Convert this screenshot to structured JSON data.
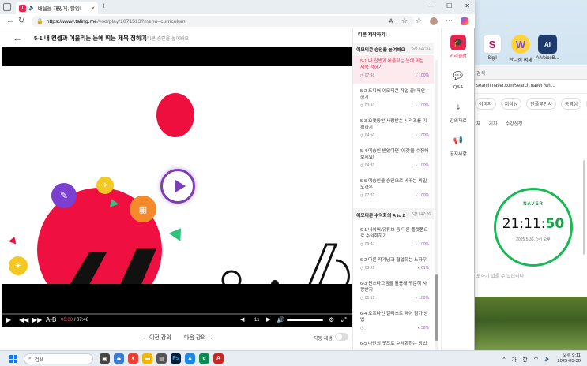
{
  "browser": {
    "tab_title": "배움을 재밌게, 탈잉!",
    "url_host": "https://www.taling.me",
    "url_path": "/vod/play/1071513?menu=curriculum"
  },
  "page": {
    "lesson_title": "5-1 내 컨셉과 어울리는 눈에 띄는 제목 정하기",
    "chapter": "이모티콘 승인율 높여봐요"
  },
  "player": {
    "ab_label": "A-B",
    "time_current": "00:00",
    "time_separator": "/",
    "time_total": "07:48",
    "speed": "1x"
  },
  "below_video": {
    "prev_label": "이전 강의",
    "next_label": "다음 강의",
    "autoplay_label": "자동 재생"
  },
  "curriculum": {
    "top_text": "티콘 제작하기!",
    "chapters": [
      {
        "name": "이모티콘 승인율 높여봐요",
        "count": "5강 / 27:51",
        "lessons": [
          {
            "title": "5-1 내 컨셉과 어울리는 눈에 띄는 제목 정하기",
            "duration": "07:48",
            "progress": "100%",
            "active": true
          },
          {
            "title": "5-2 드디어 이모티콘 작업 끝! 제안하기",
            "duration": "03:10",
            "progress": "100%"
          },
          {
            "title": "5-3 오랫동안 사랑받는 시리즈를 기획하기",
            "duration": "04:50",
            "progress": "100%"
          },
          {
            "title": "5-4 미승인 받았다면 '이것'을 수정해 보세요!",
            "duration": "04:31",
            "progress": "100%"
          },
          {
            "title": "5-5 미승인을 승인으로 바꾸는 비밀 노하우",
            "duration": "07:32",
            "progress": "100%"
          }
        ]
      },
      {
        "name": "이모티콘 수익화의 A to Z",
        "count": "5강 / 47:26",
        "lessons": [
          {
            "title": "6-1 네이버/유튜브 등 다른 플랫폼으로 수익화하기",
            "duration": "09:47",
            "progress": "100%"
          },
          {
            "title": "6-2 다른 작가님과 협업하는 노하우",
            "duration": "03:21",
            "progress": "61%"
          },
          {
            "title": "6-3 인스타그램을 활용해 꾸준히 사랑받기",
            "duration": "05:12",
            "progress": "100%"
          },
          {
            "title": "6-4 오프라인 일러스트 페어 참가 방법",
            "duration": "",
            "progress": "58%"
          },
          {
            "title": "6-5 나만의 굿즈로 수익화하는 방법",
            "duration": "",
            "progress": ""
          }
        ]
      }
    ]
  },
  "right_nav": [
    {
      "label": "커리큘럼",
      "icon": "graduation-cap-icon",
      "glyph": "🎓",
      "active": true
    },
    {
      "label": "Q&A",
      "icon": "chat-bubble-icon",
      "glyph": "💬"
    },
    {
      "label": "강의자료",
      "icon": "download-icon",
      "glyph": "⤓"
    },
    {
      "label": "공지사항",
      "icon": "megaphone-icon",
      "glyph": "📢"
    }
  ],
  "background_browser": {
    "url": "search.naver.com/search.naver?wh...",
    "search_label": "검색",
    "nav_items": [
      "이미지",
      "지식iN",
      "인플루언서",
      "동영상",
      "쇼핑"
    ],
    "sub_items": [
      "체",
      "기자",
      "수강신청"
    ],
    "clock_brand": "NAVER",
    "clock_time_hm": "21:11:",
    "clock_time_s": "50",
    "clock_date": "2025.5.30. (금) 오후",
    "note": "보하기 있을 수 있습니다"
  },
  "desktop_icons": [
    {
      "label": "Sigil",
      "color": "#b01a5a",
      "glyph": "S"
    },
    {
      "label": "반디캠 써체",
      "color": "#7a4fd8",
      "glyph": "W"
    },
    {
      "label": "AIVoiceB...",
      "color": "#1e3a6e",
      "glyph": "AI"
    }
  ],
  "taskbar": {
    "search_placeholder": "검색",
    "lang": "가",
    "lang2": "한",
    "time": "오후 9:11",
    "date": "2025-05-30"
  },
  "colors": {
    "brand": "#e8254f",
    "accent_purple": "#7b3db8",
    "progress_purple": "#9b59b6"
  }
}
